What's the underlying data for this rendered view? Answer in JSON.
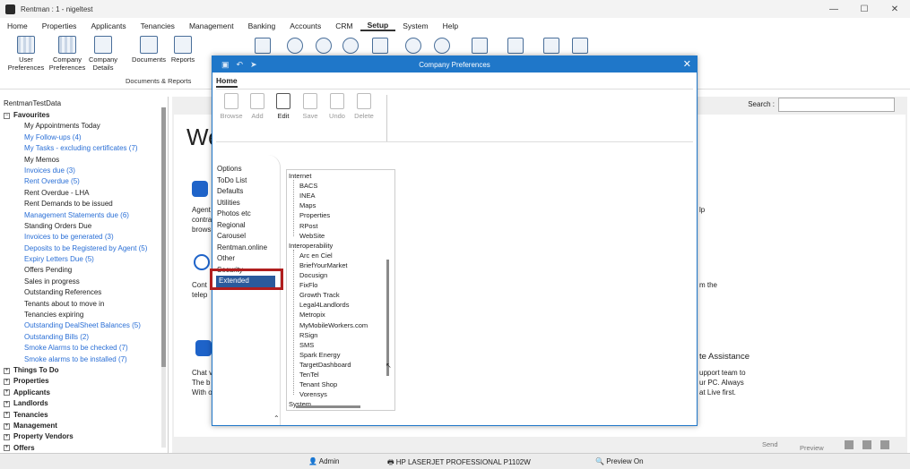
{
  "window": {
    "title": "Rentman : 1 - nigeltest"
  },
  "menu": [
    "Home",
    "Properties",
    "Applicants",
    "Tenancies",
    "Management",
    "Banking",
    "Accounts",
    "CRM",
    "Setup",
    "System",
    "Help"
  ],
  "ribbon": {
    "user_preferences": "User Preferences",
    "company_preferences": "Company Preferences",
    "company_details": "Company Details",
    "documents": "Documents",
    "reports": "Reports",
    "group_label": "Documents & Reports"
  },
  "left_panel": {
    "root": "RentmanTestData",
    "favourites_label": "Favourites",
    "favourites": [
      {
        "label": "My Appointments Today",
        "link": false
      },
      {
        "label": "My Follow-ups (4)",
        "link": true
      },
      {
        "label": "My Tasks - excluding certificates (7)",
        "link": true
      },
      {
        "label": "My Memos",
        "link": false
      },
      {
        "label": "Invoices due (3)",
        "link": true
      },
      {
        "label": "Rent Overdue (5)",
        "link": true
      },
      {
        "label": "Rent Overdue - LHA",
        "link": false
      },
      {
        "label": "Rent Demands to be issued",
        "link": false
      },
      {
        "label": "Management Statements due (6)",
        "link": true
      },
      {
        "label": "Standing Orders Due",
        "link": false
      },
      {
        "label": "Invoices to be generated (3)",
        "link": true
      },
      {
        "label": "Deposits to be Registered by Agent (5)",
        "link": true
      },
      {
        "label": "Expiry Letters Due (5)",
        "link": true
      },
      {
        "label": "Offers Pending",
        "link": false
      },
      {
        "label": "Sales in progress",
        "link": false
      },
      {
        "label": "Outstanding References",
        "link": false
      },
      {
        "label": "Tenants about to move in",
        "link": false
      },
      {
        "label": "Tenancies expiring",
        "link": false
      },
      {
        "label": "Outstanding DealSheet Balances (5)",
        "link": true
      },
      {
        "label": "Outstanding Bills (2)",
        "link": true
      },
      {
        "label": "Smoke Alarms to be checked (7)",
        "link": true
      },
      {
        "label": "Smoke alarms to be installed (7)",
        "link": true
      }
    ],
    "groups": [
      "Things To Do",
      "Properties",
      "Applicants",
      "Landlords",
      "Tenancies",
      "Management",
      "Property Vendors",
      "Offers"
    ]
  },
  "main": {
    "search_label": "Search :",
    "welcome_fragment": "We",
    "fragments": {
      "agent": "Agent",
      "contra": "contra",
      "brows": "brows",
      "cont": "Cont",
      "telep": "telep",
      "chat": "Chat v",
      "the_b": "The b",
      "with_o": "With o",
      "lp": "lp",
      "m_the": "m the",
      "assist": "te Assistance",
      "support": "upport team to",
      "pc": "ur PC. Always",
      "live": "at Live first."
    }
  },
  "status": {
    "user": "Admin",
    "printer": "HP LASERJET PROFESSIONAL P1102W",
    "preview_on": "Preview On",
    "send": "Send",
    "preview": "Preview"
  },
  "dialog": {
    "title": "Company Preferences",
    "tab": "Home",
    "buttons": [
      "Browse",
      "Add",
      "Edit",
      "Save",
      "Undo",
      "Delete"
    ],
    "options": [
      "Options",
      "ToDo List",
      "Defaults",
      "Utilities",
      "Photos etc",
      "Regional",
      "Carousel",
      "Rentman.online",
      "Other",
      "Security",
      "Extended"
    ],
    "selected_option": "Extended",
    "tree": {
      "internet_label": "Internet",
      "internet": [
        "BACS",
        "INEA",
        "Maps",
        "Properties",
        "RPost",
        "WebSite"
      ],
      "interop_label": "Interoperability",
      "interop": [
        "Arc en Ciel",
        "BriefYourMarket",
        "Docusign",
        "FixFlo",
        "Growth Track",
        "Legal4Landlords",
        "Metropix",
        "MyMobileWorkers.com",
        "RSign",
        "SMS",
        "Spark Energy",
        "TargetDashboard",
        "TenTel",
        "Tenant Shop",
        "Vorensys"
      ],
      "system_label": "System"
    }
  }
}
